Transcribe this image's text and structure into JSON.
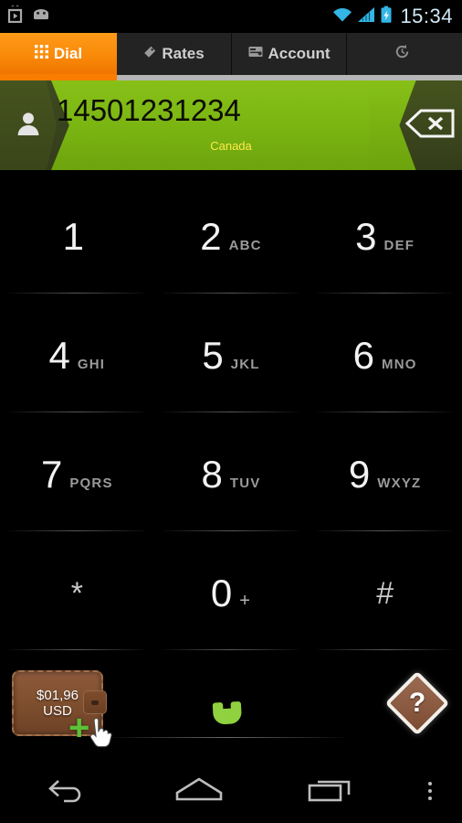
{
  "status_bar": {
    "time": "15:34",
    "notification_icons": [
      "play-store-icon",
      "android-robot-icon"
    ],
    "system_icons": [
      "wifi-icon",
      "cellular-signal-icon",
      "battery-charging-icon"
    ],
    "accent_color": "#33b5e5"
  },
  "tabs": [
    {
      "label": "Dial",
      "icon": "keypad-grid-icon",
      "active": true
    },
    {
      "label": "Rates",
      "icon": "price-tag-icon",
      "active": false
    },
    {
      "label": "Account",
      "icon": "account-card-icon",
      "active": false
    },
    {
      "label": "",
      "icon": "history-icon",
      "active": false
    }
  ],
  "tab_accent_color": "#f97d00",
  "dialer": {
    "number": "14501231234",
    "country": "Canada",
    "contact_icon": "person-icon",
    "delete_icon": "backspace-delete-icon",
    "display_color": "#7ab412",
    "country_color": "#ffe94a"
  },
  "keypad": [
    {
      "digit": "1",
      "letters": ""
    },
    {
      "digit": "2",
      "letters": "ABC"
    },
    {
      "digit": "3",
      "letters": "DEF"
    },
    {
      "digit": "4",
      "letters": "GHI"
    },
    {
      "digit": "5",
      "letters": "JKL"
    },
    {
      "digit": "6",
      "letters": "MNO"
    },
    {
      "digit": "7",
      "letters": "PQRS"
    },
    {
      "digit": "8",
      "letters": "TUV"
    },
    {
      "digit": "9",
      "letters": "WXYZ"
    },
    {
      "digit": "*",
      "letters": ""
    },
    {
      "digit": "0",
      "letters": "+"
    },
    {
      "digit": "#",
      "letters": ""
    }
  ],
  "actions": {
    "balance_amount": "$01,96",
    "balance_currency": "USD",
    "wallet_icon": "wallet-icon",
    "add_credit_icon": "green-plus-icon",
    "cursor_icon": "hand-cursor-icon",
    "call_icon": "green-phone-handset-icon",
    "help_label": "?",
    "help_icon": "help-diamond-icon",
    "call_color": "#8fd13f"
  },
  "nav_bar": {
    "back_icon": "back-arrow-icon",
    "home_icon": "home-icon",
    "recents_icon": "recent-apps-icon",
    "menu_icon": "overflow-menu-icon"
  }
}
